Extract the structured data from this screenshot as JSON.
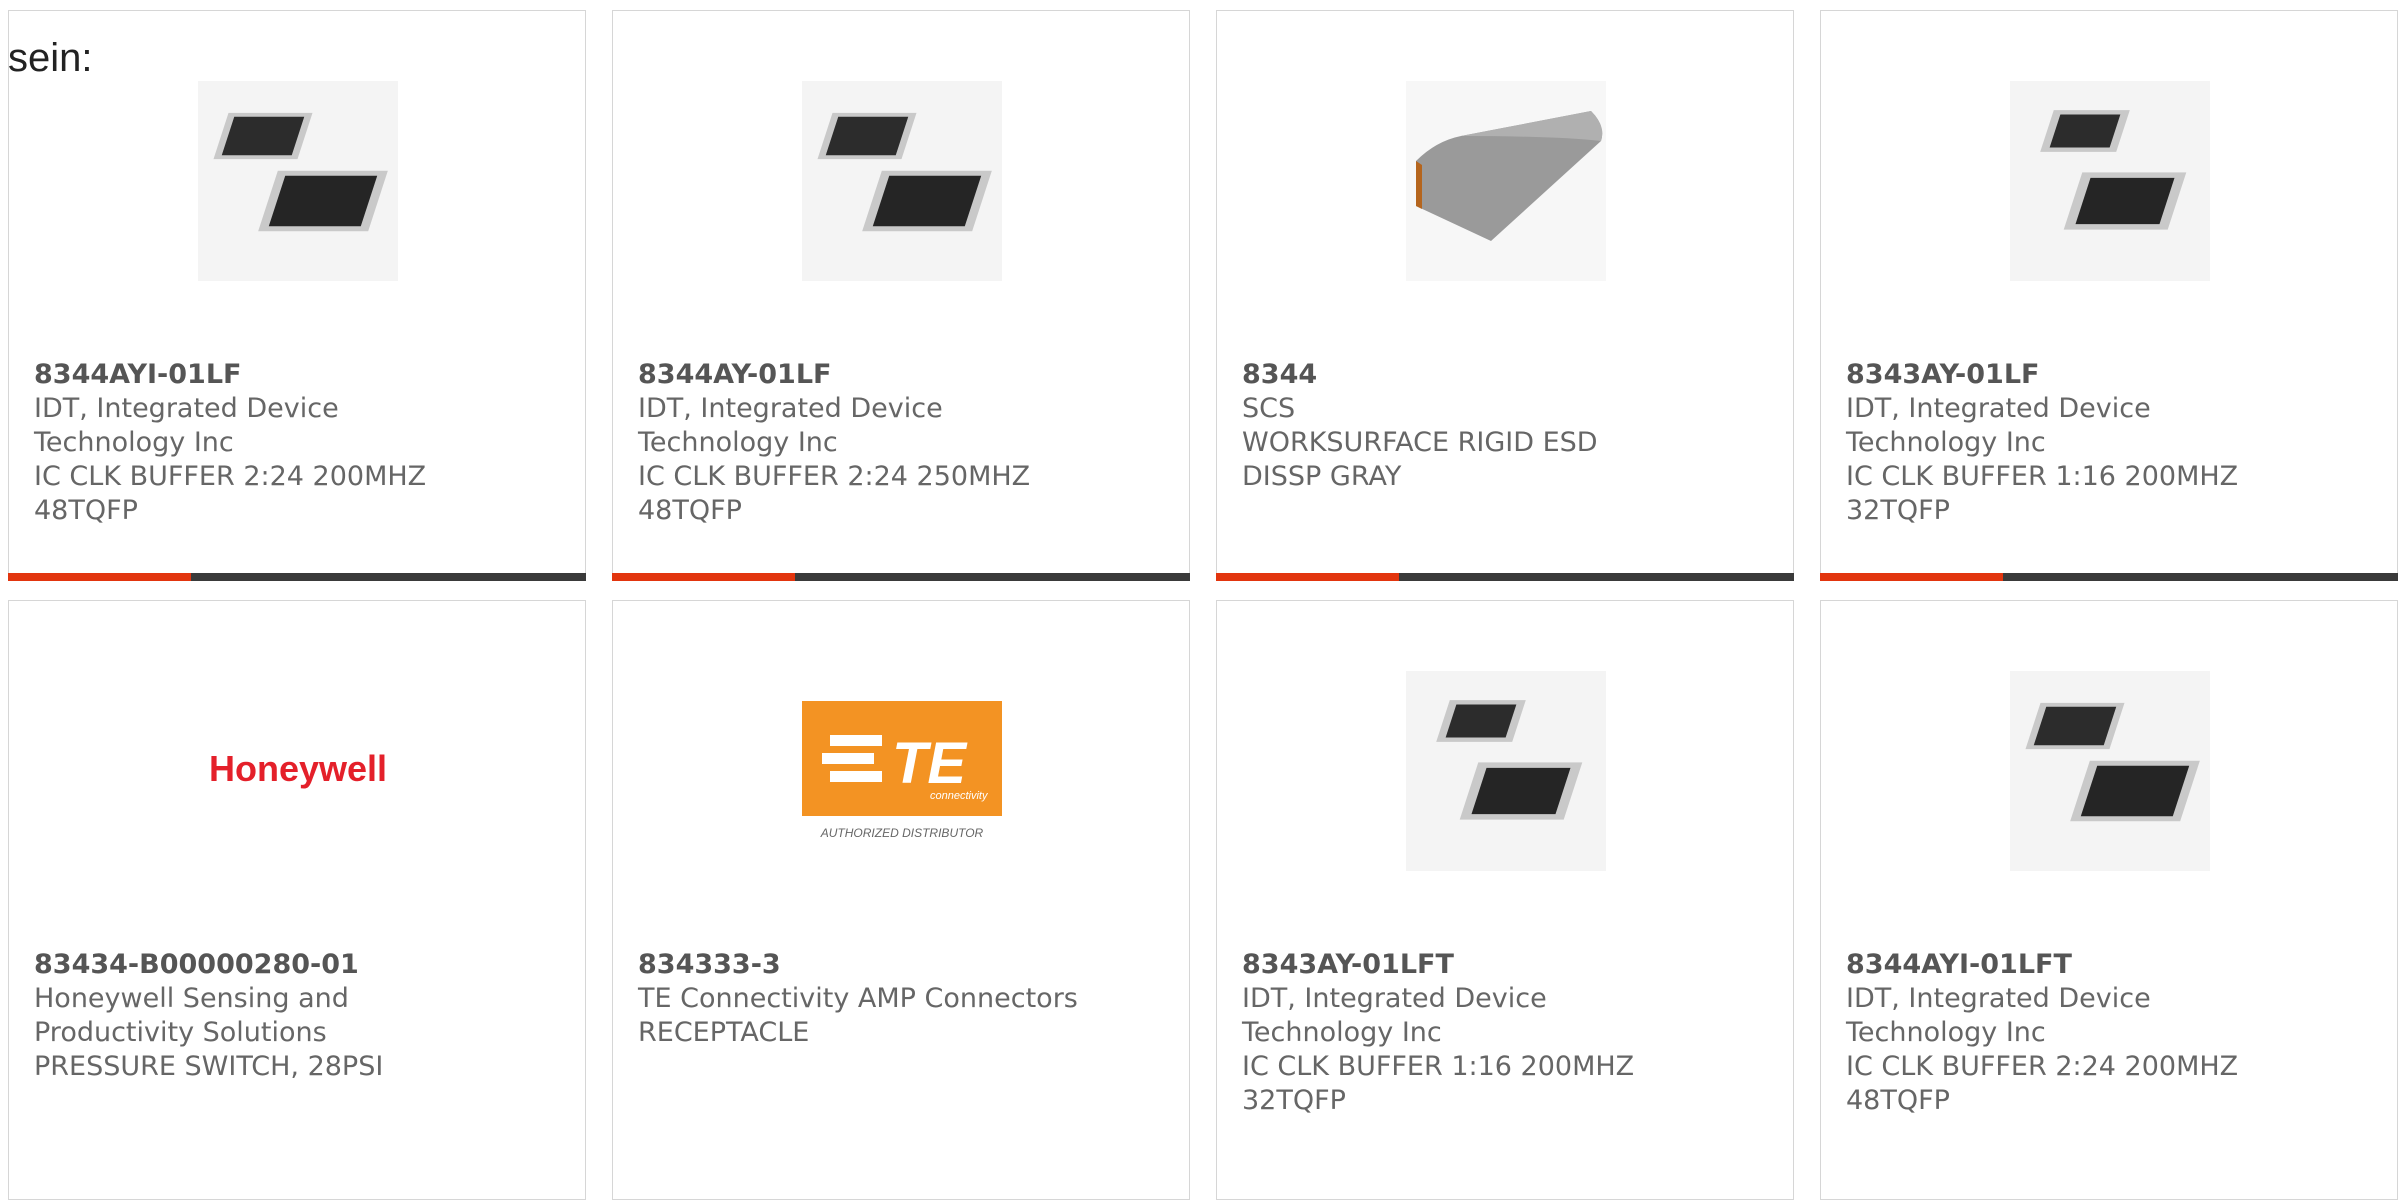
{
  "heading": "sein:",
  "colors": {
    "accent": "#e2350e",
    "bar": "#3a3a3a",
    "text": "#666666"
  },
  "products": [
    {
      "part_number": "8344AYI-01LF",
      "manufacturer": "IDT, Integrated Device Technology Inc",
      "description": "IC CLK BUFFER 2:24 200MHZ 48TQFP",
      "image": "qfp-chip-pair"
    },
    {
      "part_number": "8344AY-01LF",
      "manufacturer": "IDT, Integrated Device Technology Inc",
      "description": "IC CLK BUFFER 2:24 250MHZ 48TQFP",
      "image": "qfp-chip-pair"
    },
    {
      "part_number": "8344",
      "manufacturer": "SCS",
      "description": "WORKSURFACE RIGID ESD DISSP GRAY",
      "image": "esd-mat-sheet"
    },
    {
      "part_number": "8343AY-01LF",
      "manufacturer": "IDT, Integrated Device Technology Inc",
      "description": "IC CLK BUFFER 1:16 200MHZ 32TQFP",
      "image": "qfp-chip-pair-small"
    },
    {
      "part_number": "83434-B00000280-01",
      "manufacturer": "Honeywell Sensing and Productivity Solutions",
      "description": "PRESSURE SWITCH, 28PSI",
      "image": "honeywell-logo",
      "logo_text": "Honeywell"
    },
    {
      "part_number": "834333-3",
      "manufacturer": "TE Connectivity AMP Connectors",
      "description": "RECEPTACLE",
      "image": "te-connectivity-logo",
      "logo_text": "TE",
      "logo_subtext": "connectivity",
      "logo_caption": "AUTHORIZED DISTRIBUTOR"
    },
    {
      "part_number": "8343AY-01LFT",
      "manufacturer": "IDT, Integrated Device Technology Inc",
      "description": "IC CLK BUFFER 1:16 200MHZ 32TQFP",
      "image": "qfp-chip-pair-small"
    },
    {
      "part_number": "8344AYI-01LFT",
      "manufacturer": "IDT, Integrated Device Technology Inc",
      "description": "IC CLK BUFFER 2:24 200MHZ 48TQFP",
      "image": "qfp-chip-pair"
    }
  ]
}
